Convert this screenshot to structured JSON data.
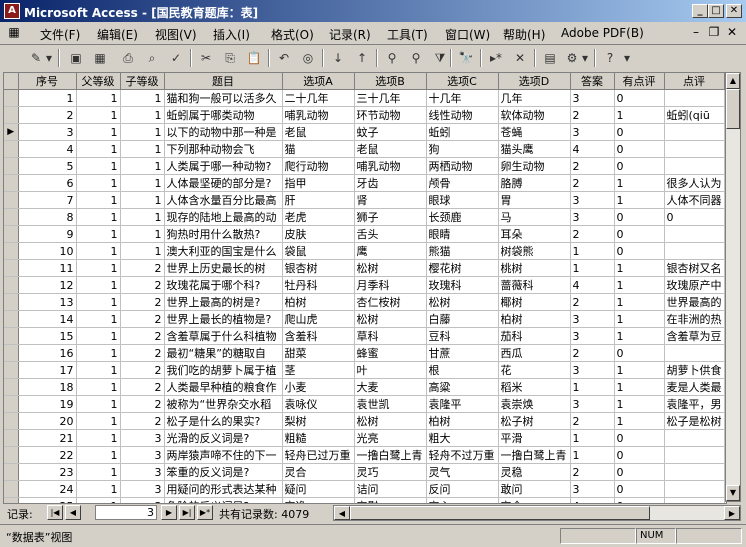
{
  "window": {
    "title": "Microsoft Access - [国民教育题库：表]",
    "minimize": "_",
    "restore": "□",
    "close": "✕"
  },
  "menu": {
    "items": [
      "文件(F)",
      "编辑(E)",
      "视图(V)",
      "插入(I)",
      "格式(O)",
      "记录(R)",
      "工具(T)",
      "窗口(W)",
      "帮助(H)",
      "Adobe PDF(B)"
    ],
    "doc_min": "–",
    "doc_restore": "❐",
    "doc_close": "✕"
  },
  "toolbar": {
    "icons": [
      "view-icon",
      "save-icon",
      "print-icon",
      "print-preview-icon",
      "spellcheck-icon",
      "cut-icon",
      "copy-icon",
      "paste-icon",
      "undo-icon",
      "sort-asc-icon",
      "sort-desc-icon",
      "filter-by-selection-icon",
      "filter-by-form-icon",
      "apply-filter-icon",
      "find-icon",
      "new-record-icon",
      "delete-record-icon",
      "database-window-icon",
      "new-object-icon",
      "help-icon"
    ],
    "glyphs": [
      "✎",
      "▣",
      "▦",
      "⎙",
      "⌕",
      "✓",
      "✂",
      "⎘",
      "📋",
      "↶",
      "↓",
      "↑",
      "⚲",
      "⚲",
      "⧩",
      "🔭",
      "▸*",
      "✕",
      "▤",
      "⚙",
      "?"
    ]
  },
  "grid": {
    "columns": [
      "序号",
      "父等级",
      "子等级",
      "题目",
      "选项A",
      "选项B",
      "选项C",
      "选项D",
      "答案",
      "有点评",
      "点评"
    ],
    "rows": [
      [
        "1",
        "1",
        "1",
        "猫和狗一般可以活多久",
        "二十几年",
        "三十几年",
        "十几年",
        "几年",
        "3",
        "0",
        ""
      ],
      [
        "2",
        "1",
        "1",
        "蚯蚓属于哪类动物",
        "哺乳动物",
        "环节动物",
        "线性动物",
        "软体动物",
        "2",
        "1",
        "蚯蚓(qiū"
      ],
      [
        "3",
        "1",
        "1",
        "以下的动物中那一种是",
        "老鼠",
        "蚊子",
        "蚯蚓",
        "苍蝇",
        "3",
        "0",
        ""
      ],
      [
        "4",
        "1",
        "1",
        "下列那种动物会飞",
        "猫",
        "老鼠",
        "狗",
        "猫头鹰",
        "4",
        "0",
        ""
      ],
      [
        "5",
        "1",
        "1",
        "人类属于哪一种动物?",
        "爬行动物",
        "哺乳动物",
        "两栖动物",
        "卵生动物",
        "2",
        "0",
        ""
      ],
      [
        "6",
        "1",
        "1",
        "人体最坚硬的部分是?",
        "指甲",
        "牙齿",
        "颅骨",
        "胳膊",
        "2",
        "1",
        "很多人认为"
      ],
      [
        "7",
        "1",
        "1",
        "人体含水量百分比最高",
        "肝",
        "肾",
        "眼球",
        "胃",
        "3",
        "1",
        "人体不同器"
      ],
      [
        "8",
        "1",
        "1",
        "现存的陆地上最高的动",
        "老虎",
        "狮子",
        "长颈鹿",
        "马",
        "3",
        "0",
        "0"
      ],
      [
        "9",
        "1",
        "1",
        "狗热时用什么散热?",
        "皮肤",
        "舌头",
        "眼睛",
        "耳朵",
        "2",
        "0",
        ""
      ],
      [
        "10",
        "1",
        "1",
        "澳大利亚的国宝是什么",
        "袋鼠",
        "鹰",
        "熊猫",
        "树袋熊",
        "1",
        "0",
        ""
      ],
      [
        "11",
        "1",
        "2",
        "世界上历史最长的树",
        "银杏树",
        "松树",
        "樱花树",
        "桃树",
        "1",
        "1",
        "银杏树又名"
      ],
      [
        "12",
        "1",
        "2",
        "玫瑰花属于哪个科?",
        "牡丹科",
        "月季科",
        "玫瑰科",
        "蔷薇科",
        "4",
        "1",
        "玫瑰原产中"
      ],
      [
        "13",
        "1",
        "2",
        "世界上最高的树是?",
        "柏树",
        "杏仁桉树",
        "松树",
        "椰树",
        "2",
        "1",
        "世界最高的"
      ],
      [
        "14",
        "1",
        "2",
        "世界上最长的植物是?",
        "爬山虎",
        "松树",
        "白藤",
        "柏树",
        "3",
        "1",
        "在非洲的热"
      ],
      [
        "15",
        "1",
        "2",
        "含羞草属于什么科植物",
        "含羞科",
        "草科",
        "豆科",
        "茄科",
        "3",
        "1",
        "含羞草为豆"
      ],
      [
        "16",
        "1",
        "2",
        "最初“糖果”的糖取自",
        "甜菜",
        "蜂蜜",
        "甘蔗",
        "西瓜",
        "2",
        "0",
        ""
      ],
      [
        "17",
        "1",
        "2",
        "我们吃的胡萝卜属于植",
        "茎",
        "叶",
        "根",
        "花",
        "3",
        "1",
        "胡萝卜供食"
      ],
      [
        "18",
        "1",
        "2",
        "人类最早种植的粮食作",
        "小麦",
        "大麦",
        "高粱",
        "稻米",
        "1",
        "1",
        "麦是人类最"
      ],
      [
        "19",
        "1",
        "2",
        "被称为“世界杂交水稻",
        "袁咏仪",
        "袁世凯",
        "袁隆平",
        "袁崇焕",
        "3",
        "1",
        "袁隆平，男"
      ],
      [
        "20",
        "1",
        "2",
        "松子是什么的果实?",
        "梨树",
        "松树",
        "柏树",
        "松子树",
        "2",
        "1",
        "松子是松树"
      ],
      [
        "21",
        "1",
        "3",
        "光滑的反义词是?",
        "粗糙",
        "光亮",
        "粗大",
        "平滑",
        "1",
        "0",
        ""
      ],
      [
        "22",
        "1",
        "3",
        "两岸猿声啼不住的下一",
        "轻舟已过万重",
        "一撸白鹭上青",
        "轻舟不过万重",
        "一撸白鹭上青",
        "1",
        "0",
        ""
      ],
      [
        "23",
        "1",
        "3",
        "笨重的反义词是?",
        "灵合",
        "灵巧",
        "灵气",
        "灵稳",
        "2",
        "0",
        ""
      ],
      [
        "24",
        "1",
        "3",
        "用疑问的形式表达某种",
        "疑问",
        "诘问",
        "反问",
        "敢问",
        "3",
        "0",
        ""
      ],
      [
        "25",
        "1",
        "3",
        "危险的反义词是?",
        "安逸",
        "安慰",
        "安心",
        "安全",
        "4",
        "0",
        ""
      ],
      [
        "26",
        "1",
        "3",
        "表示人或者事物、时间",
        "动词",
        "副词",
        "形容词",
        "名词",
        "4",
        "0",
        "名词 (Nou"
      ]
    ],
    "current_row_marker": "▶",
    "current_row_index": 2
  },
  "navigation": {
    "label": "记录:",
    "first": "|◀",
    "prev": "◀",
    "current": "3",
    "next": "▶",
    "last": "▶|",
    "new": "▶*",
    "total_text": "共有记录数: 4079"
  },
  "status": {
    "text": "“数据表”视图",
    "num": "NUM"
  }
}
